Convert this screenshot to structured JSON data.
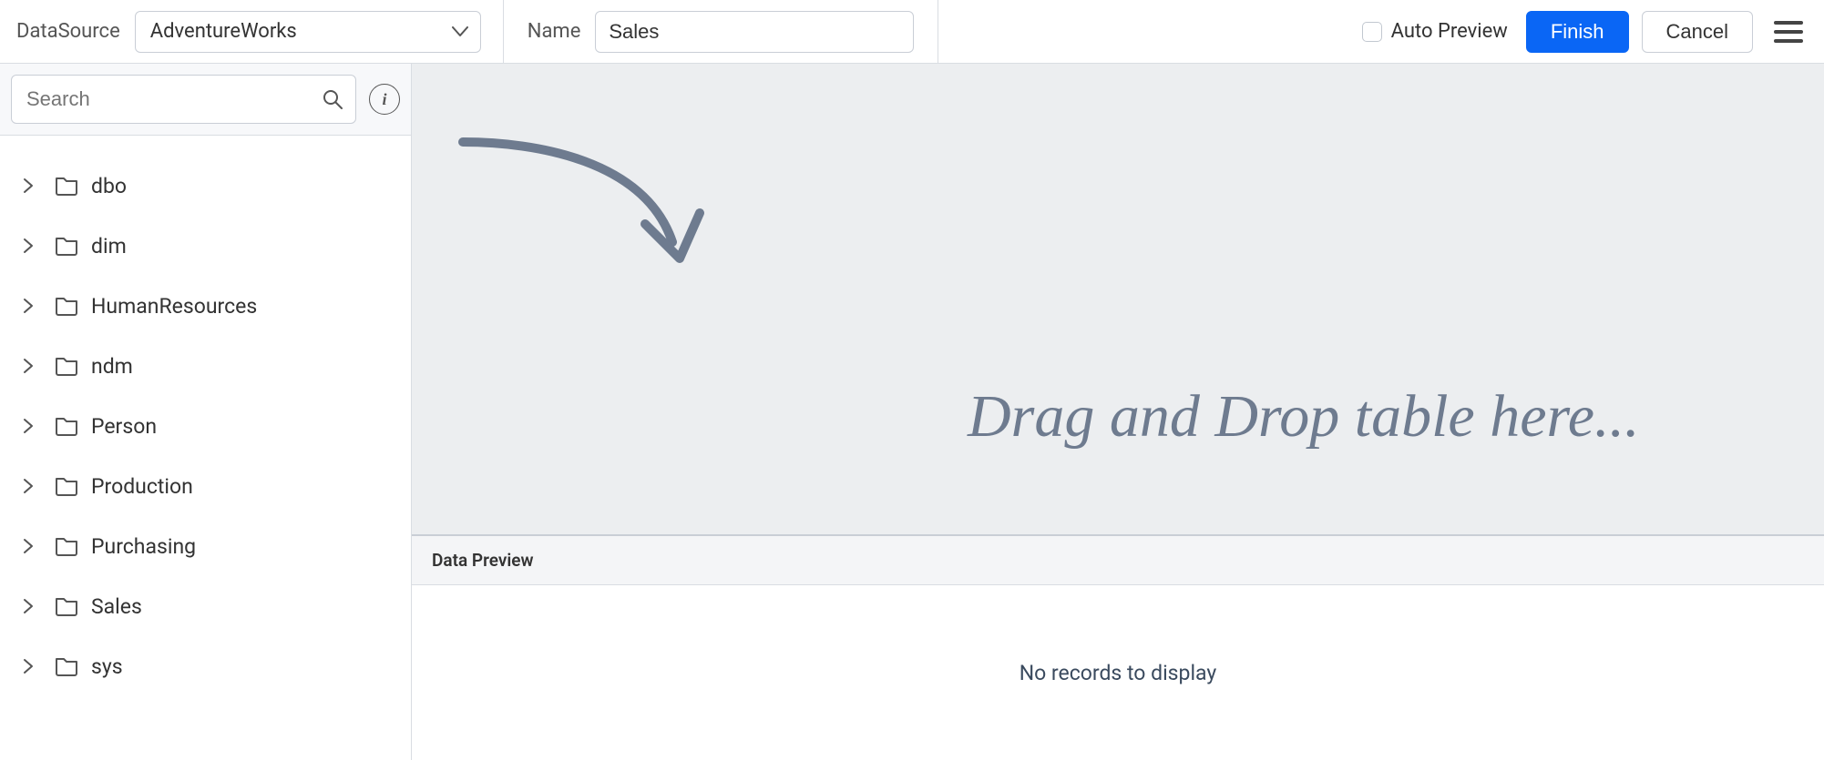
{
  "topbar": {
    "datasource_label": "DataSource",
    "datasource_value": "AdventureWorks",
    "name_label": "Name",
    "name_value": "Sales",
    "auto_preview_label": "Auto Preview",
    "finish_label": "Finish",
    "cancel_label": "Cancel"
  },
  "sidebar": {
    "search_placeholder": "Search",
    "items": [
      {
        "label": "dbo"
      },
      {
        "label": "dim"
      },
      {
        "label": "HumanResources"
      },
      {
        "label": "ndm"
      },
      {
        "label": "Person"
      },
      {
        "label": "Production"
      },
      {
        "label": "Purchasing"
      },
      {
        "label": "Sales"
      },
      {
        "label": "sys"
      }
    ]
  },
  "canvas": {
    "drop_hint": "Drag and Drop table here..."
  },
  "preview": {
    "header": "Data Preview",
    "empty_text": "No records to display"
  }
}
